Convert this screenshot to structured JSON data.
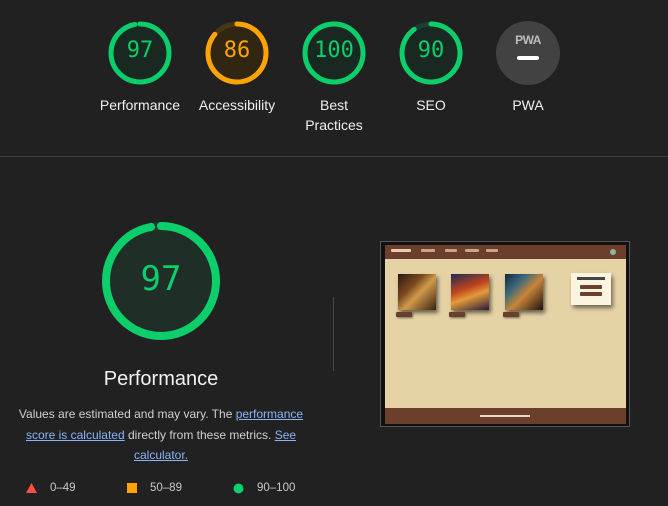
{
  "summary": {
    "gauges": [
      {
        "score": "97",
        "label": "Performance",
        "color": "#0cce6b",
        "fraction": 0.97
      },
      {
        "score": "86",
        "label": "Accessibility",
        "color": "#ffa400",
        "fraction": 0.86
      },
      {
        "score": "100",
        "label_line1": "Best",
        "label_line2": "Practices",
        "color": "#0cce6b",
        "fraction": 1.0
      },
      {
        "score": "90",
        "label": "SEO",
        "color": "#0cce6b",
        "fraction": 0.9
      },
      {
        "badge": "PWA",
        "label": "PWA",
        "color": "#424242"
      }
    ]
  },
  "category": {
    "score": "97",
    "fraction": 0.97,
    "title": "Performance",
    "desc_prefix": "Values are estimated and may vary. The ",
    "link1": "performance score is calculated",
    "desc_middle": " directly from these metrics. ",
    "link2": "See calculator.",
    "legend": [
      {
        "range": "0–49",
        "shape": "triangle-icon",
        "color": "#ff4e42"
      },
      {
        "range": "50–89",
        "shape": "square-icon",
        "color": "#ffa400"
      },
      {
        "range": "90–100",
        "shape": "circle-icon",
        "color": "#0cce6b"
      }
    ]
  }
}
